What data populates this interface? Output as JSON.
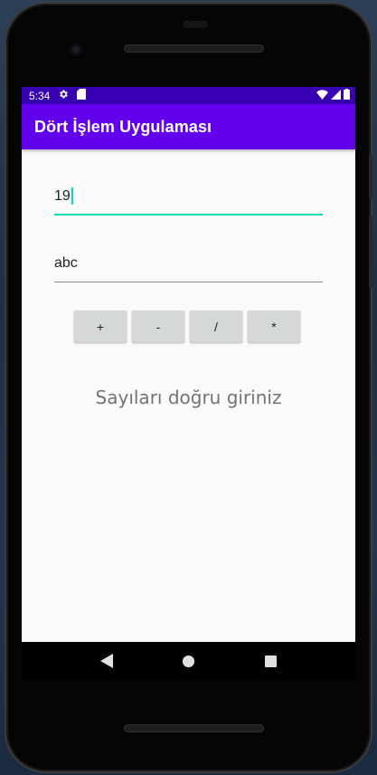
{
  "status_bar": {
    "time": "5:34",
    "icons": [
      "settings-icon",
      "sd-card-icon",
      "wifi-icon",
      "signal-icon",
      "battery-icon"
    ]
  },
  "app_bar": {
    "title": "Dört İşlem Uygulaması"
  },
  "inputs": {
    "first_number": {
      "value": "19",
      "focused": true
    },
    "second_number": {
      "value": "abc",
      "focused": false
    }
  },
  "operations": [
    {
      "label": "+"
    },
    {
      "label": "-"
    },
    {
      "label": "/"
    },
    {
      "label": "*"
    }
  ],
  "result": {
    "text": "Sayıları doğru giriniz"
  },
  "navigation": {
    "icons": [
      "back-icon",
      "home-icon",
      "recents-icon"
    ]
  },
  "colors": {
    "status_bar": "#3700b3",
    "app_bar": "#6200ee",
    "accent": "#03dac5",
    "button": "#d6d7d7",
    "result_text": "#737373"
  }
}
